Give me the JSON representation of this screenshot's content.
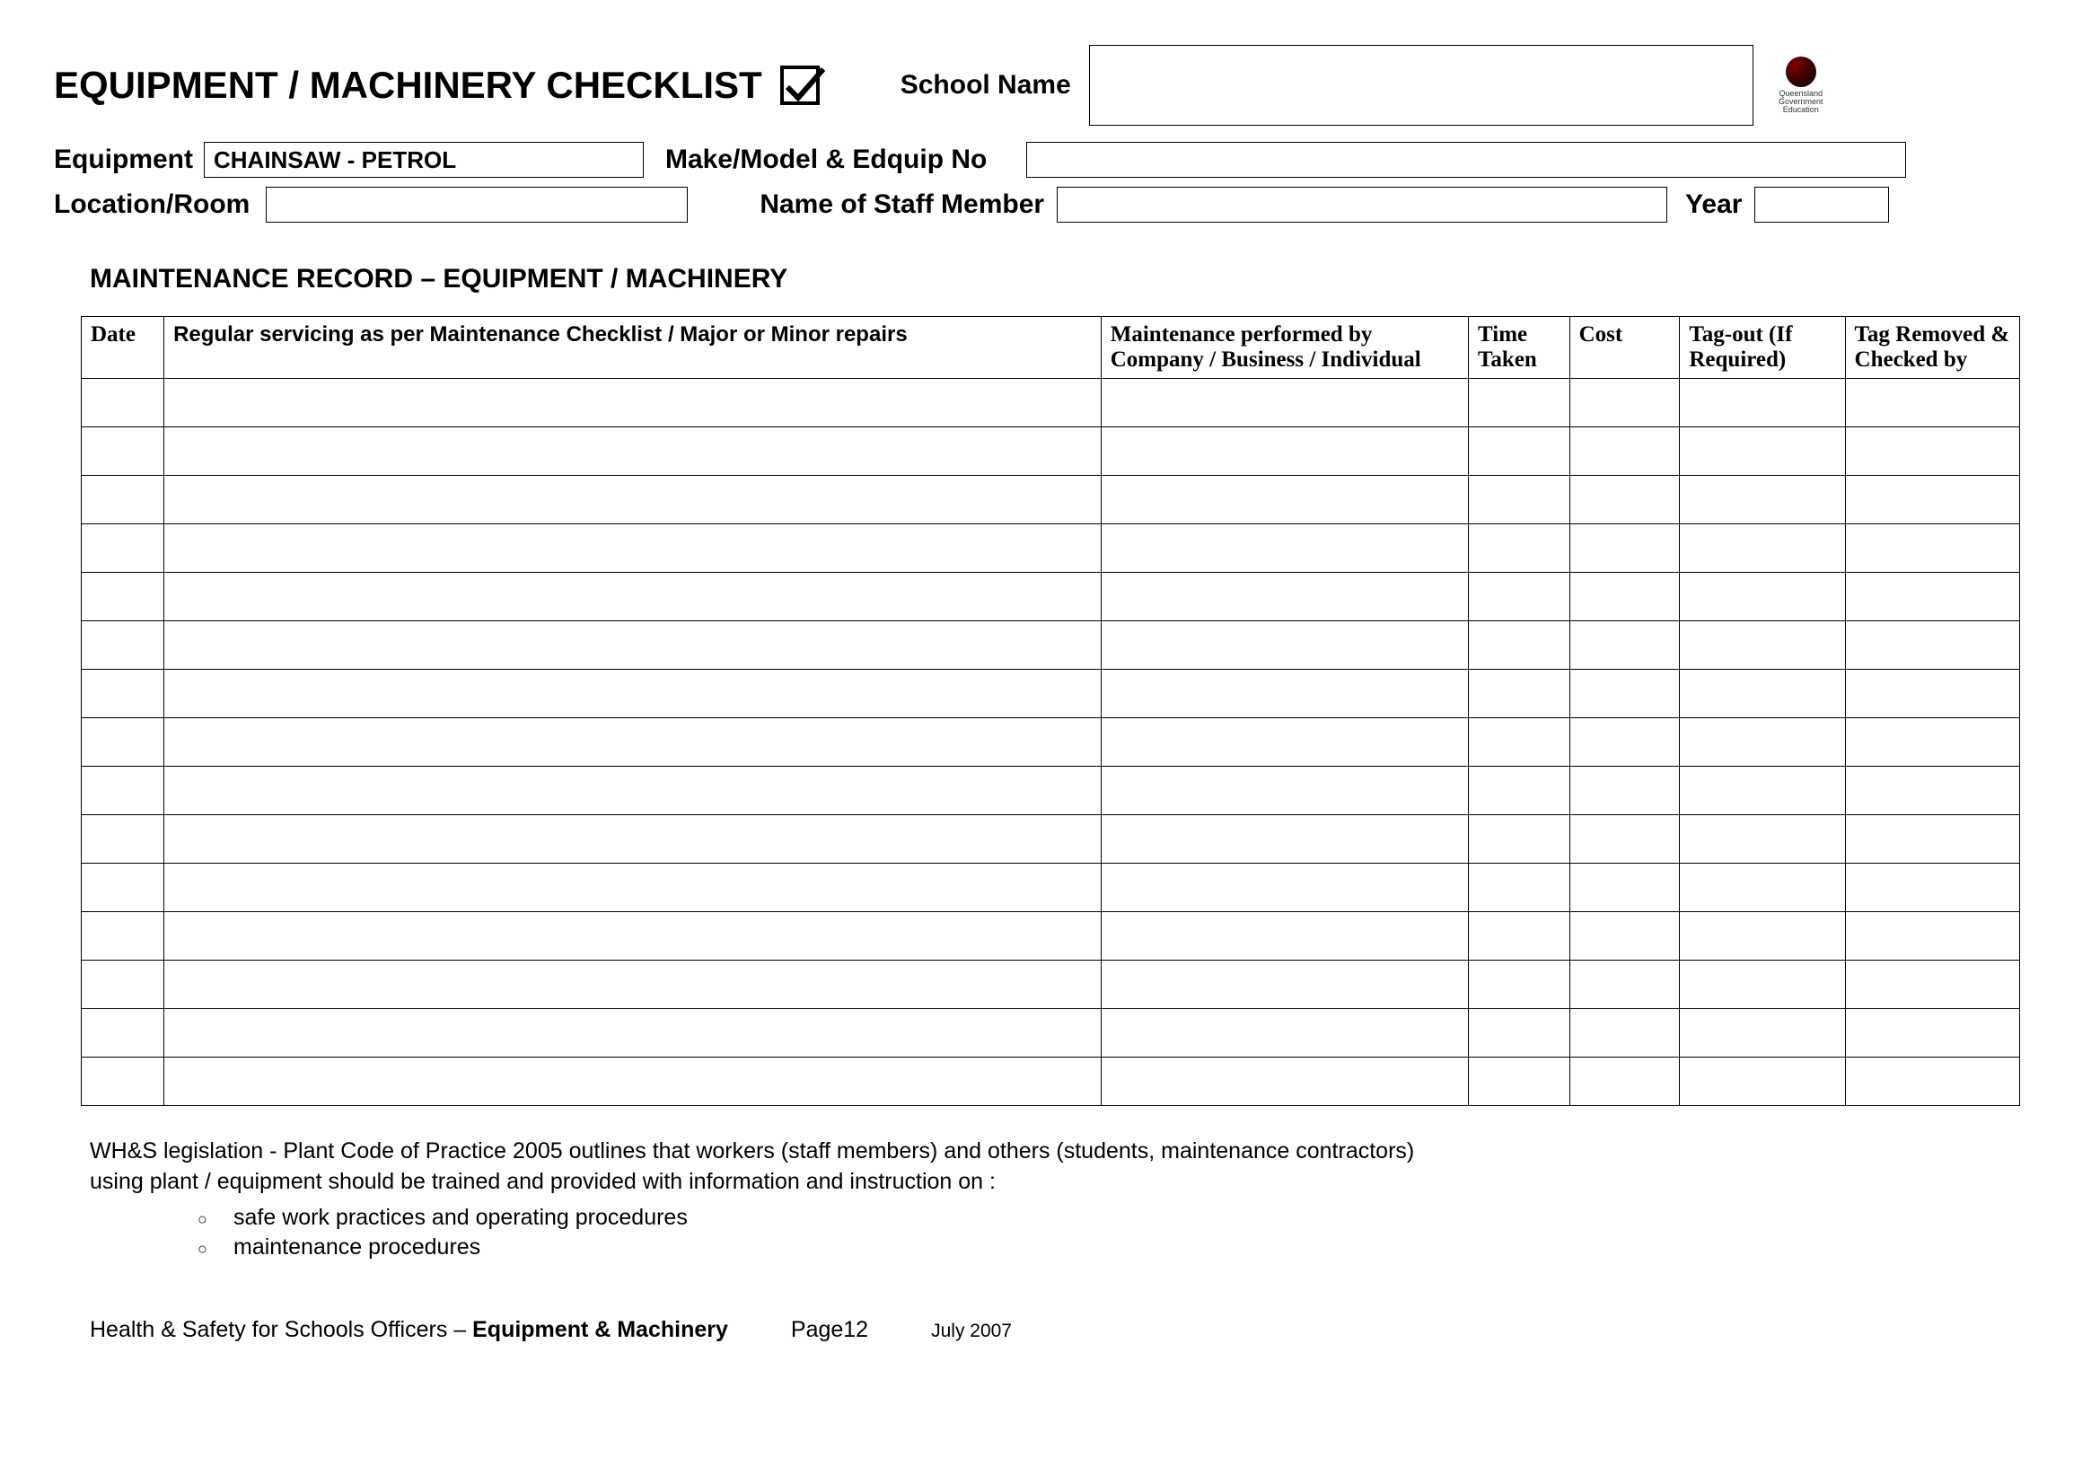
{
  "title": "EQUIPMENT / MACHINERY CHECKLIST",
  "labels": {
    "school_name": "School Name",
    "equipment": "Equipment",
    "make_model": "Make/Model & Edquip No",
    "location_room": "Location/Room",
    "staff_member": "Name of Staff Member",
    "year": "Year"
  },
  "equipment_value": "CHAINSAW -  PETROL",
  "section_title": "MAINTENANCE RECORD – EQUIPMENT / MACHINERY",
  "table": {
    "headers": {
      "date": "Date",
      "servicing": "Regular servicing as per Maintenance Checklist / Major or Minor repairs",
      "performed_by": "Maintenance performed by Company / Business / Individual",
      "time_taken": "Time Taken",
      "cost": "Cost",
      "tag_out": "Tag-out (If Required)",
      "tag_removed": "Tag Removed & Checked by"
    },
    "row_count": 15
  },
  "note": {
    "line1": "WH&S legislation - Plant Code of Practice 2005 outlines that workers (staff members) and others (students, maintenance contractors)",
    "line2": "using plant / equipment should be trained and provided with information and instruction on :",
    "bullets": [
      "safe work practices and operating procedures",
      "maintenance procedures"
    ]
  },
  "footer": {
    "left_prefix": "Health & Safety for Schools Officers – ",
    "left_bold": "Equipment & Machinery",
    "page": "Page12",
    "date": "July 2007"
  },
  "logo_text": "Queensland Government Education"
}
